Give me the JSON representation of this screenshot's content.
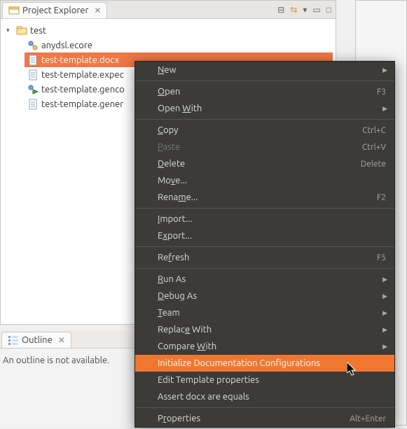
{
  "explorer": {
    "title": "Project Explorer",
    "toolbar": {
      "collapse": "⊟",
      "link": "⇆",
      "menu": "▾",
      "min": "▭",
      "max": "□"
    },
    "root": {
      "label": "test",
      "expanded": true
    },
    "items": [
      {
        "label": "anydsl.ecore",
        "type": "ecore"
      },
      {
        "label": "test-template.docx",
        "type": "doc",
        "selected": true
      },
      {
        "label": "test-template.expec",
        "type": "doc"
      },
      {
        "label": "test-template.genco",
        "type": "gen"
      },
      {
        "label": "test-template.gener",
        "type": "doc"
      }
    ]
  },
  "outline": {
    "title": "Outline",
    "message": "An outline is not available."
  },
  "context_menu": [
    {
      "label": "New",
      "mn": 0,
      "submenu": true
    },
    {
      "sep": true
    },
    {
      "label": "Open",
      "mn": 0,
      "accel": "F3"
    },
    {
      "label": "Open With",
      "mn": 5,
      "submenu": true
    },
    {
      "sep": true
    },
    {
      "label": "Copy",
      "mn": 0,
      "accel": "Ctrl+C"
    },
    {
      "label": "Paste",
      "mn": 0,
      "accel": "Ctrl+V",
      "disabled": true
    },
    {
      "label": "Delete",
      "mn": 0,
      "accel": "Delete"
    },
    {
      "label": "Move...",
      "mn": 2
    },
    {
      "label": "Rename...",
      "mn": 4,
      "accel": "F2"
    },
    {
      "sep": true
    },
    {
      "label": "Import...",
      "mn": 0
    },
    {
      "label": "Export...",
      "mn": 1
    },
    {
      "sep": true
    },
    {
      "label": "Refresh",
      "mn": 2,
      "accel": "F5"
    },
    {
      "sep": true
    },
    {
      "label": "Run As",
      "mn": 0,
      "submenu": true
    },
    {
      "label": "Debug As",
      "mn": 0,
      "submenu": true
    },
    {
      "label": "Team",
      "mn": 0,
      "submenu": true
    },
    {
      "label": "Replace With",
      "mn": 6,
      "submenu": true
    },
    {
      "label": "Compare With",
      "mn": 8,
      "submenu": true
    },
    {
      "label": "Initialize Documentation Configurations",
      "highlight": true
    },
    {
      "label": "Edit Template properties"
    },
    {
      "label": "Assert docx are equals"
    },
    {
      "sep": true
    },
    {
      "label": "Properties",
      "mn": 1,
      "accel": "Alt+Enter"
    }
  ]
}
